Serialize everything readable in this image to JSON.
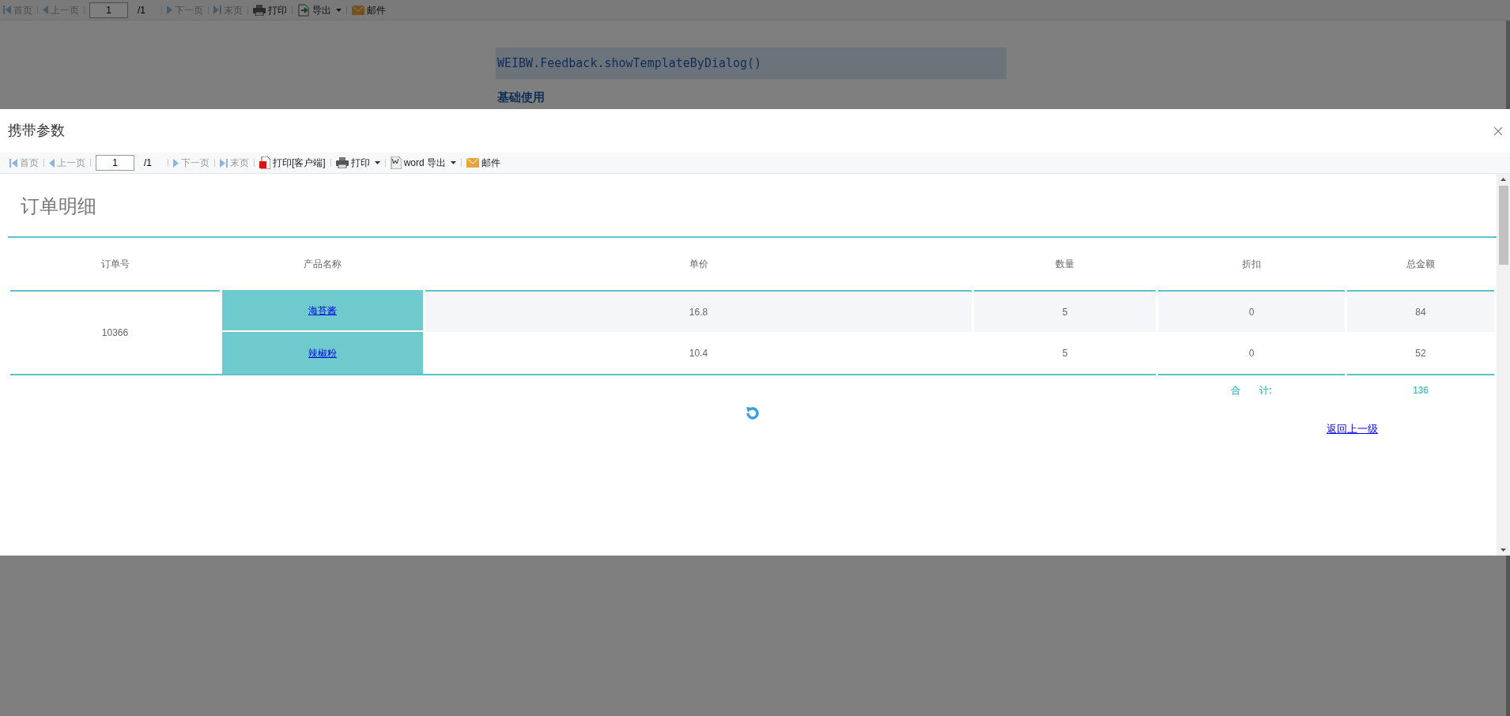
{
  "page": {
    "toolbar": [
      {
        "kind": "first",
        "label": "首页",
        "disabled": true
      },
      {
        "kind": "prev",
        "label": "上一页",
        "disabled": true
      },
      {
        "kind": "page",
        "value": "1"
      },
      {
        "kind": "total",
        "label": "/1"
      },
      {
        "kind": "next",
        "label": "下一页",
        "disabled": true
      },
      {
        "kind": "last",
        "label": "末页",
        "disabled": true
      },
      {
        "kind": "print",
        "label": "打印",
        "dropdown": false
      },
      {
        "kind": "export",
        "label": "导出",
        "dropdown": true
      },
      {
        "kind": "mail",
        "label": "邮件"
      }
    ],
    "code": "WEIBW.Feedback.showTemplateByDialog()",
    "heading": "基础使用"
  },
  "dialog": {
    "title": "携带参数",
    "toolbar": [
      {
        "kind": "first",
        "label": "首页",
        "disabled": true
      },
      {
        "kind": "prev",
        "label": "上一页",
        "disabled": true
      },
      {
        "kind": "page",
        "value": "1"
      },
      {
        "kind": "total",
        "label": "/1"
      },
      {
        "kind": "next",
        "label": "下一页",
        "disabled": true
      },
      {
        "kind": "last",
        "label": "末页",
        "disabled": true
      },
      {
        "kind": "clientprint",
        "label": "打印[客户端]"
      },
      {
        "kind": "print",
        "label": "打印",
        "dropdown": true
      },
      {
        "kind": "word",
        "label": "word 导出",
        "dropdown": true
      },
      {
        "kind": "mail",
        "label": "邮件"
      }
    ],
    "report": {
      "title": "订单明细",
      "columns": [
        "订单号",
        "产品名称",
        "单价",
        "数量",
        "折扣",
        "总金额"
      ],
      "order": "10366",
      "rows": [
        {
          "product": "海苔酱",
          "price": "16.8",
          "qty": "5",
          "discount": "0",
          "total": "84"
        },
        {
          "product": "辣椒粉",
          "price": "10.4",
          "qty": "5",
          "discount": "0",
          "total": "52"
        }
      ],
      "sum_label": "合　　计:",
      "sum": "136",
      "back_link": "返回上一级"
    }
  }
}
